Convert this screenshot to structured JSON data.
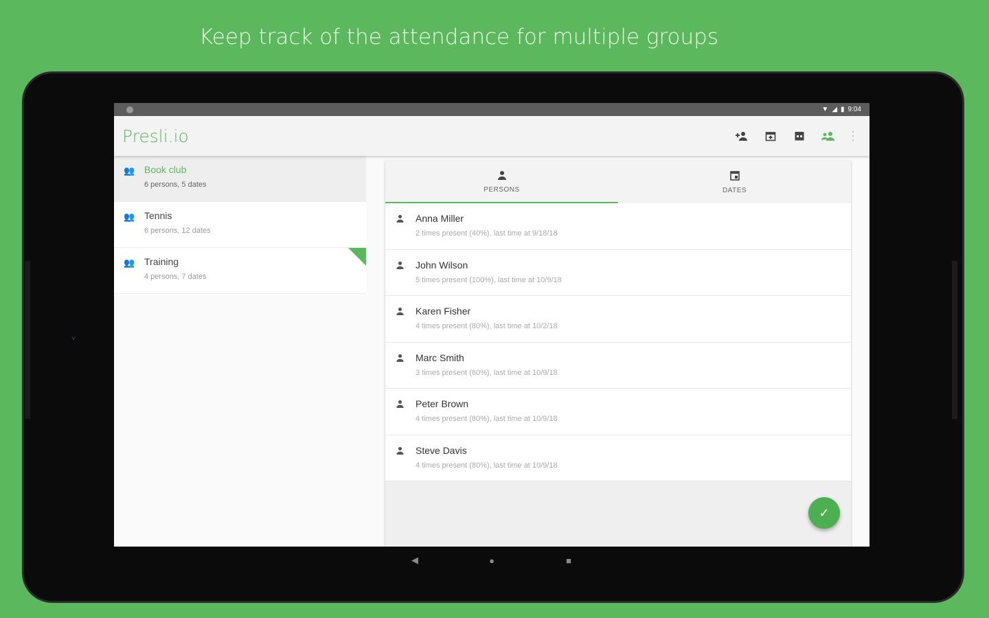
{
  "headline": "Keep track of the attendance for multiple groups",
  "status": {
    "time": "9:04",
    "icons": [
      "wifi-icon",
      "signal-icon",
      "battery-icon"
    ]
  },
  "appbar": {
    "title": "Presli.io",
    "actions": [
      "add-person-icon",
      "add-date-icon",
      "calendar-icon",
      "manage-persons-icon",
      "more-icon"
    ]
  },
  "groups": [
    {
      "name": "Book club",
      "summary": "6 persons, 5 dates",
      "selected": true
    },
    {
      "name": "Tennis",
      "summary": "6 persons, 12 dates",
      "selected": false
    },
    {
      "name": "Training",
      "summary": "4 persons, 7 dates",
      "selected": false
    }
  ],
  "tabs": [
    {
      "label": "PERSONS",
      "icon": "person-icon",
      "active": true
    },
    {
      "label": "DATES",
      "icon": "calendar-icon",
      "active": false
    }
  ],
  "persons": [
    {
      "name": "Anna Miller",
      "detail": "2 times present (40%), last time at 9/18/18"
    },
    {
      "name": "John Wilson",
      "detail": "5 times present (100%), last time at 10/9/18"
    },
    {
      "name": "Karen Fisher",
      "detail": "4 times present (80%), last time at 10/2/18"
    },
    {
      "name": "Marc Smith",
      "detail": "3 times present (60%), last time at 10/9/18"
    },
    {
      "name": "Peter Brown",
      "detail": "4 times present (80%), last time at 10/9/18"
    },
    {
      "name": "Steve Davis",
      "detail": "4 times present (80%), last time at 10/9/18"
    }
  ],
  "colors": {
    "brand_green": "#5cb85c",
    "fab_green": "#4caf50"
  }
}
